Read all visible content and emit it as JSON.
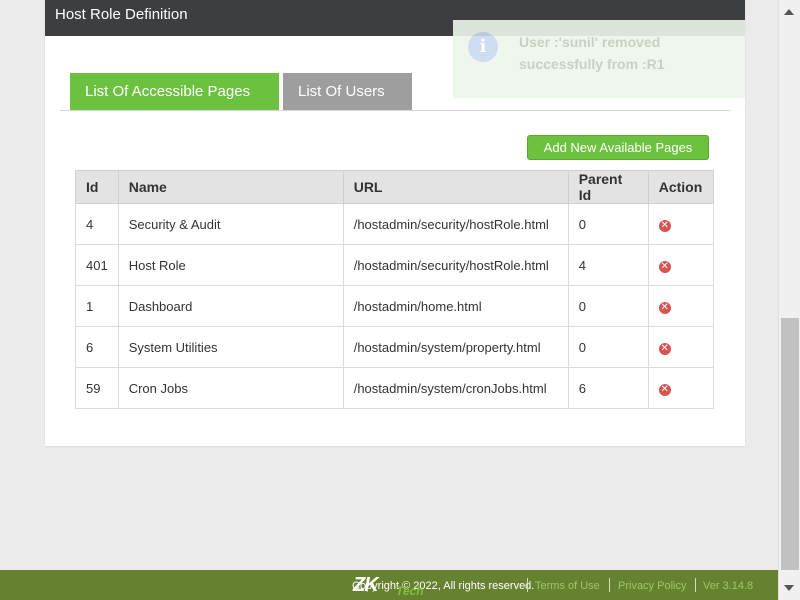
{
  "panel": {
    "title": "Host Role Definition"
  },
  "tabs": [
    {
      "label": "List Of Accessible Pages"
    },
    {
      "label": "List Of Users"
    }
  ],
  "add_button_label": "Add New Available Pages",
  "table": {
    "headers": [
      "Id",
      "Name",
      "URL",
      "Parent Id",
      "Action"
    ],
    "rows": [
      {
        "id": "4",
        "name": "Security & Audit",
        "url": "/hostadmin/security/hostRole.html",
        "parent": "0"
      },
      {
        "id": "401",
        "name": "Host Role",
        "url": "/hostadmin/security/hostRole.html",
        "parent": "4"
      },
      {
        "id": "1",
        "name": "Dashboard",
        "url": "/hostadmin/home.html",
        "parent": "0"
      },
      {
        "id": "6",
        "name": "System Utilities",
        "url": "/hostadmin/system/property.html",
        "parent": "0"
      },
      {
        "id": "59",
        "name": "Cron Jobs",
        "url": "/hostadmin/system/cronJobs.html",
        "parent": "6"
      }
    ]
  },
  "toast": {
    "message": "User :'sunil' removed successfully from :R1",
    "icon": "info-icon"
  },
  "footer": {
    "copyright": "Copyright © 2022, All rights reserved.",
    "terms": "Terms of Use",
    "privacy": "Privacy Policy",
    "version": "Ver 3.14.8",
    "logo": "ZK",
    "logo_sub": "Tech"
  },
  "colors": {
    "accent_green": "#6cc13f",
    "header_dark": "#3c3e40",
    "footer_green": "#668231",
    "delete_red": "#d9534f"
  }
}
